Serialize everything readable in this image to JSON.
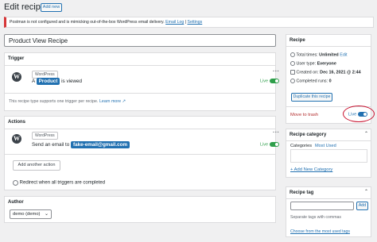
{
  "header": {
    "title": "Edit recipe",
    "add_new": "Add new"
  },
  "notice": {
    "text": "Postman is not configured and is mimicking out-of-the-box WordPress email delivery.",
    "links": [
      "Email Log",
      "Settings"
    ]
  },
  "recipe_title": "Product View Recipe",
  "trigger": {
    "heading": "Trigger",
    "integration": "WordPress",
    "sentence_pre": "A",
    "token": "Product",
    "sentence_post": "is viewed",
    "status": "Live",
    "note": "This recipe type supports one trigger per recipe.",
    "learn_more": "Learn more"
  },
  "actions": {
    "heading": "Actions",
    "integration": "WordPress",
    "sentence_pre": "Send an email to",
    "token": "fake-email@gmail.com",
    "status": "Live",
    "add_action": "Add another action",
    "redirect_label": "Redirect when all triggers are completed"
  },
  "author": {
    "heading": "Author",
    "selected": "demo (demo)"
  },
  "recipe_box": {
    "heading": "Recipe",
    "total_times_label": "Total times:",
    "total_times_value": "Unlimited",
    "edit": "Edit",
    "user_type_label": "User type:",
    "user_type_value": "Everyone",
    "created_label": "Created on:",
    "created_value": "Dec 16, 2021 @ 2:44",
    "completed_label": "Completed runs:",
    "completed_value": "0",
    "duplicate": "Duplicate this recipe",
    "trash": "Move to trash",
    "live": "Live"
  },
  "category": {
    "heading": "Recipe category",
    "tabs": [
      "Categories",
      "Most Used"
    ],
    "add_new": "+ Add New Category"
  },
  "tag": {
    "heading": "Recipe tag",
    "add": "Add",
    "hint": "Separate tags with commas",
    "choose": "Choose from the most used tags"
  },
  "colors": {
    "accent": "#2271b1",
    "live_green": "#2e9e4a",
    "trash_red": "#b32d2e",
    "highlight": "#c8102e"
  }
}
